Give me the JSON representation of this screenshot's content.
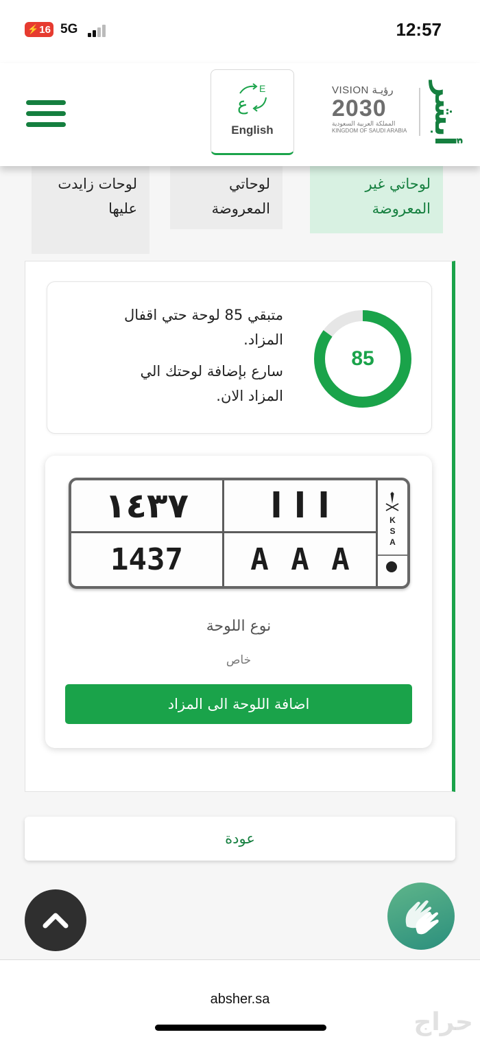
{
  "status_bar": {
    "battery": "16",
    "network": "5G",
    "time": "12:57"
  },
  "header": {
    "language_button_label": "English",
    "vision_title": "VISION رؤيـة",
    "vision_year": "2030",
    "vision_subtitle_ar": "المملكة العربية السعودية",
    "vision_subtitle_en": "KINGDOM OF SAUDI ARABIA",
    "brand": "أبشر"
  },
  "tabs": [
    {
      "label": "لوحاتي غير المعروضة",
      "active": true
    },
    {
      "label": "لوحاتي المعروضة",
      "active": false
    },
    {
      "label": "لوحات زايدت عليها",
      "active": false
    }
  ],
  "info_card": {
    "line1": "متبقي 85 لوحة حتي اقفال المزاد.",
    "line2": "سارع بإضافة لوحتك الي المزاد الان.",
    "remaining_count": "85",
    "progress_fraction": 0.85
  },
  "plate": {
    "number_ar": "١٤٣٧",
    "letters_ar": "ا ا ا",
    "number_en": "1437",
    "letters_en": "A A A",
    "country_code": "KSA"
  },
  "plate_type": {
    "label": "نوع اللوحة",
    "value": "خاص"
  },
  "add_button_label": "اضافة اللوحة الى المزاد",
  "back_button_label": "عودة",
  "browser": {
    "url": "absher.sa",
    "watermark": "حراج"
  },
  "colors": {
    "brand_green": "#157f3f",
    "accent_green": "#1aa34a",
    "active_tab_bg": "#d8f1e2"
  },
  "icons": {
    "menu": "hamburger-icon",
    "language": "language-switch-icon",
    "scroll_top": "chevron-up-icon",
    "accessibility": "sign-language-icon"
  }
}
